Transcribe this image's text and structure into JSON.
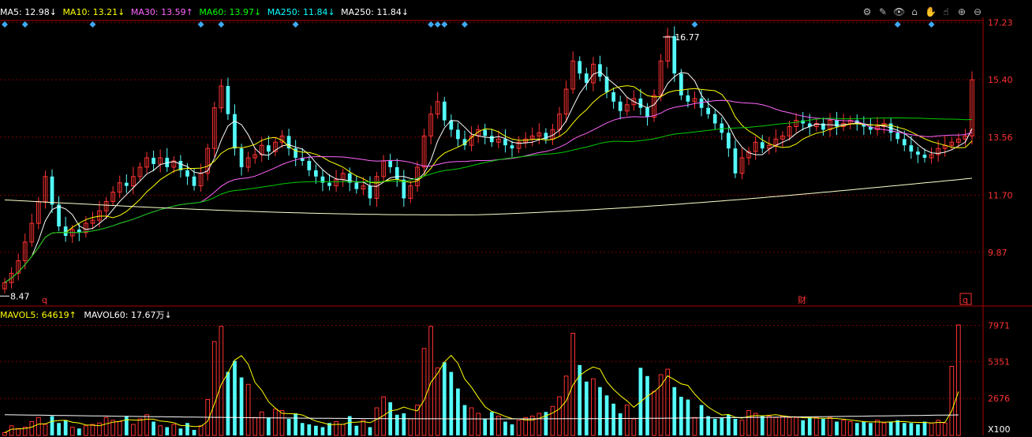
{
  "indicators": {
    "ma5": {
      "label": "MA5: 12.98↓",
      "color": "#ffffff"
    },
    "ma10": {
      "label": "MA10: 13.21↓",
      "color": "#ffff00"
    },
    "ma30": {
      "label": "MA30: 13.59↑",
      "color": "#ff66ff"
    },
    "ma60": {
      "label": "MA60: 13.97↓",
      "color": "#00ff00"
    },
    "ma250a": {
      "label": "MA250: 11.84↓",
      "color": "#00ffff"
    },
    "ma250b": {
      "label": "MA250: 11.84↓",
      "color": "#ffffff"
    }
  },
  "vol_indicators": {
    "mavol5": {
      "label": "MAVOL5: 64619↑",
      "color": "#ffff00"
    },
    "mavol60": {
      "label": "MAVOL60: 17.67万↓",
      "color": "#ffffff"
    }
  },
  "toolbar": [
    "gear-icon",
    "pen-icon",
    "eye-icon",
    "gift-icon",
    "hand-icon",
    "pointer-icon",
    "zoom-in-icon",
    "zoom-out-icon"
  ],
  "toolbar_glyphs": [
    "⚙",
    "✎",
    "👁",
    "⌂",
    "✋",
    "☝",
    "⊕",
    "⊖"
  ],
  "price_axis": {
    "labels": [
      "17.23",
      "15.40",
      "13.56",
      "11.70",
      "9.87"
    ],
    "values": [
      17.23,
      15.4,
      13.56,
      11.7,
      9.87
    ],
    "min": 8.2,
    "max": 17.4
  },
  "vol_axis": {
    "labels": [
      "7971",
      "5351",
      "2676",
      "X100"
    ],
    "values": [
      7971,
      5351,
      2676
    ],
    "max": 8000
  },
  "annotations": {
    "high": "16.77",
    "low": "8.47",
    "high_value": 16.77,
    "low_value": 8.47
  },
  "markers": {
    "q1": "q",
    "cai": "财",
    "q2": "q"
  },
  "colors": {
    "up": "#ff3232",
    "down": "#54fcfc",
    "grid": "#7a0000",
    "axis": "#aa0000",
    "bg": "#000000"
  },
  "chart_data": {
    "type": "candlestick",
    "close": [
      8.9,
      9.2,
      9.6,
      10.2,
      10.8,
      11.5,
      12.3,
      11.4,
      10.7,
      10.4,
      10.6,
      10.5,
      10.8,
      10.9,
      11.2,
      11.5,
      11.8,
      12.1,
      12.0,
      12.3,
      12.6,
      12.9,
      12.7,
      12.9,
      12.6,
      12.8,
      12.5,
      12.3,
      12.0,
      12.4,
      13.2,
      14.5,
      15.2,
      14.3,
      13.2,
      12.6,
      12.9,
      13.0,
      13.3,
      13.1,
      13.4,
      13.6,
      13.2,
      12.9,
      12.8,
      12.5,
      12.3,
      12.1,
      12.0,
      12.2,
      12.4,
      12.1,
      11.9,
      12.0,
      11.6,
      12.3,
      12.8,
      12.6,
      12.2,
      11.6,
      12.0,
      12.6,
      13.6,
      14.3,
      14.7,
      14.1,
      13.8,
      13.5,
      13.3,
      13.6,
      13.8,
      13.6,
      13.4,
      13.5,
      13.3,
      13.2,
      13.4,
      13.5,
      13.6,
      13.7,
      13.5,
      13.8,
      14.3,
      15.1,
      16.0,
      15.6,
      15.3,
      15.9,
      15.5,
      15.0,
      14.7,
      14.4,
      14.6,
      14.8,
      14.5,
      14.2,
      14.9,
      16.0,
      16.8,
      15.6,
      14.9,
      14.7,
      14.8,
      14.5,
      14.3,
      14.0,
      13.7,
      13.2,
      12.4,
      12.9,
      13.1,
      13.4,
      13.2,
      13.3,
      13.5,
      13.6,
      13.9,
      14.1,
      14.0,
      13.9,
      14.0,
      13.8,
      14.1,
      13.9,
      14.0,
      14.1,
      14.0,
      13.9,
      13.8,
      13.9,
      14.0,
      13.7,
      13.5,
      13.3,
      13.1,
      13.0,
      12.9,
      13.0,
      13.2,
      13.3,
      13.4,
      13.5,
      13.6,
      15.4
    ],
    "open": [
      8.7,
      8.9,
      9.2,
      9.6,
      10.2,
      10.8,
      11.5,
      12.3,
      11.4,
      10.7,
      10.4,
      10.6,
      10.5,
      10.8,
      10.9,
      11.2,
      11.5,
      11.8,
      12.1,
      12.0,
      12.3,
      12.6,
      12.9,
      12.7,
      12.9,
      12.6,
      12.8,
      12.5,
      12.3,
      12.0,
      12.4,
      13.2,
      14.5,
      15.2,
      14.3,
      13.2,
      12.6,
      12.9,
      13.0,
      13.3,
      13.1,
      13.4,
      13.6,
      13.2,
      12.9,
      12.8,
      12.5,
      12.3,
      12.1,
      12.0,
      12.2,
      12.4,
      12.1,
      11.9,
      12.0,
      11.6,
      12.3,
      12.8,
      12.6,
      12.2,
      11.6,
      12.0,
      12.6,
      13.6,
      14.3,
      14.7,
      14.1,
      13.8,
      13.5,
      13.3,
      13.6,
      13.8,
      13.6,
      13.4,
      13.5,
      13.3,
      13.2,
      13.4,
      13.5,
      13.6,
      13.7,
      13.5,
      13.8,
      14.3,
      15.1,
      16.0,
      15.6,
      15.3,
      15.9,
      15.5,
      15.0,
      14.7,
      14.4,
      14.6,
      14.8,
      14.5,
      14.2,
      14.9,
      16.0,
      16.8,
      15.6,
      14.9,
      14.7,
      14.8,
      14.5,
      14.3,
      14.0,
      13.7,
      13.2,
      12.4,
      12.9,
      13.1,
      13.4,
      13.2,
      13.3,
      13.5,
      13.6,
      13.9,
      14.1,
      14.0,
      13.9,
      14.0,
      13.8,
      14.1,
      13.9,
      14.0,
      14.1,
      14.0,
      13.9,
      13.8,
      13.9,
      14.0,
      13.7,
      13.5,
      13.3,
      13.1,
      13.0,
      12.9,
      13.0,
      13.2,
      13.3,
      13.4,
      13.5,
      13.6
    ],
    "volume": [
      200,
      700,
      500,
      600,
      1000,
      1300,
      800,
      1400,
      900,
      1100,
      600,
      500,
      700,
      800,
      900,
      1300,
      1100,
      1000,
      1400,
      800,
      1200,
      1500,
      1000,
      700,
      600,
      800,
      500,
      900,
      400,
      700,
      2600,
      6800,
      7900,
      4600,
      5400,
      4200,
      3700,
      1300,
      1700,
      1300,
      1900,
      1800,
      1200,
      1600,
      900,
      800,
      700,
      600,
      900,
      1000,
      800,
      1400,
      700,
      1100,
      600,
      2000,
      2800,
      2400,
      1500,
      1600,
      1200,
      2200,
      6300,
      7900,
      4900,
      5300,
      4600,
      3400,
      2200,
      2000,
      1600,
      1200,
      1700,
      1400,
      1000,
      800,
      1100,
      1300,
      1400,
      1600,
      1700,
      2100,
      2800,
      4300,
      7400,
      5100,
      3900,
      4100,
      3500,
      2900,
      2300,
      1600,
      2200,
      1200,
      4900,
      4300,
      3200,
      4400,
      4800,
      3500,
      2800,
      2600,
      1300,
      2200,
      1400,
      1200,
      1300,
      1500,
      1200,
      1100,
      1800,
      1600,
      1400,
      1400,
      1300,
      1400,
      1300,
      1300,
      1100,
      1300,
      1300,
      1200,
      1300,
      1000,
      1100,
      1000,
      900,
      1000,
      900,
      1100,
      900,
      1000,
      1100,
      900,
      900,
      800,
      1000,
      900,
      1100,
      900,
      5000,
      8000
    ]
  }
}
